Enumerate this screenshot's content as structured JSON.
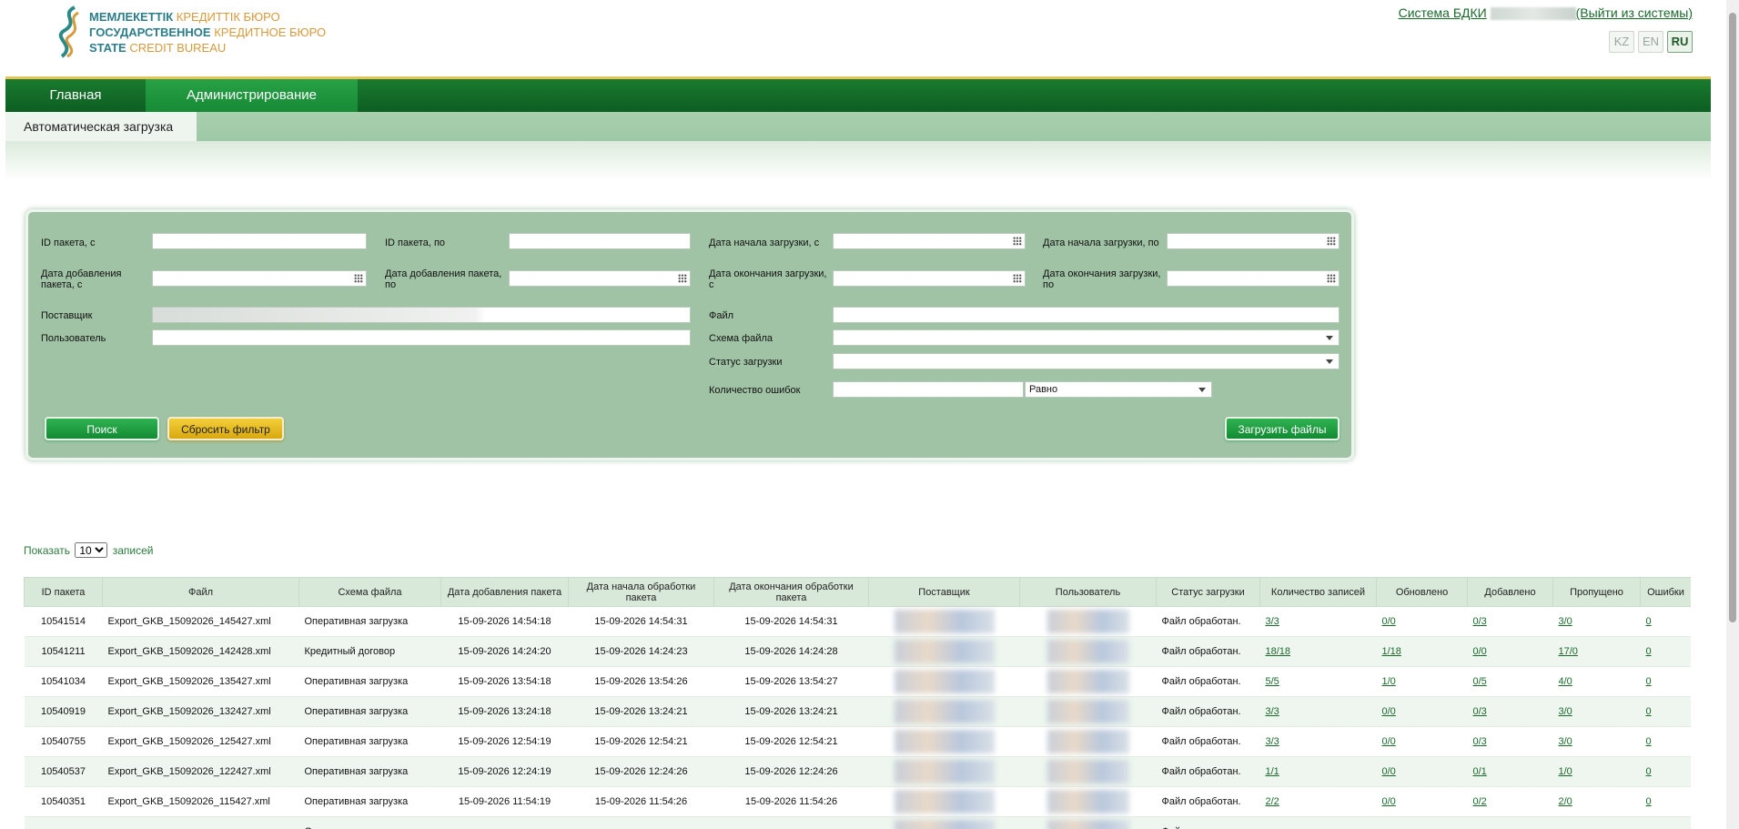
{
  "header": {
    "logo_lines": [
      {
        "bold": "МЕМЛЕКЕТТІК",
        "rest": "КРЕДИТТІК БЮРО"
      },
      {
        "bold": "ГОСУДАРСТВЕННОЕ",
        "rest": "КРЕДИТНОЕ БЮРО"
      },
      {
        "bold": "STATE",
        "rest": "CREDIT BUREAU"
      }
    ],
    "system_link": "Система БДКИ",
    "logout_link": "(Выйти из системы)",
    "languages": [
      "KZ",
      "EN",
      "RU"
    ],
    "active_language": "RU"
  },
  "nav": {
    "main": "Главная",
    "admin": "Администрирование",
    "subtab": "Автоматическая загрузка"
  },
  "filter": {
    "package_id_from": "ID пакета, с",
    "package_id_to": "ID пакета, по",
    "load_start_from": "Дата начала загрузки, с",
    "load_start_to": "Дата начала загрузки, по",
    "added_from": "Дата добавления пакета, с",
    "added_to": "Дата добавления пакета, по",
    "load_end_from": "Дата окончания загрузки, с",
    "load_end_to": "Дата окончания загрузки, по",
    "supplier": "Поставщик",
    "user": "Пользователь",
    "file": "Файл",
    "schema": "Схема файла",
    "status": "Статус загрузки",
    "error_count": "Количество ошибок",
    "error_operator": "Равно",
    "search_btn": "Поиск",
    "reset_btn": "Сбросить фильтр",
    "upload_btn": "Загрузить файлы"
  },
  "show": {
    "prefix": "Показать",
    "value": "10",
    "suffix": "записей"
  },
  "table": {
    "headers": [
      "ID пакета",
      "Файл",
      "Схема файла",
      "Дата добавления пакета",
      "Дата начала обработки пакета",
      "Дата окончания обработки пакета",
      "Поставщик",
      "Пользователь",
      "Статус загрузки",
      "Количество записей",
      "Обновлено",
      "Добавлено",
      "Пропущено",
      "Ошибки"
    ],
    "rows": [
      [
        "10541514",
        "Export_GKB_15092026_145427.xml",
        "Оперативная загрузка",
        "15-09-2026 14:54:18",
        "15-09-2026 14:54:31",
        "15-09-2026 14:54:31",
        "Файл обработан.",
        "3/3",
        "0/0",
        "0/3",
        "3/0",
        "0"
      ],
      [
        "10541211",
        "Export_GKB_15092026_142428.xml",
        "Кредитный договор",
        "15-09-2026 14:24:20",
        "15-09-2026 14:24:23",
        "15-09-2026 14:24:28",
        "Файл обработан.",
        "18/18",
        "1/18",
        "0/0",
        "17/0",
        "0"
      ],
      [
        "10541034",
        "Export_GKB_15092026_135427.xml",
        "Оперативная загрузка",
        "15-09-2026 13:54:18",
        "15-09-2026 13:54:26",
        "15-09-2026 13:54:27",
        "Файл обработан.",
        "5/5",
        "1/0",
        "0/5",
        "4/0",
        "0"
      ],
      [
        "10540919",
        "Export_GKB_15092026_132427.xml",
        "Оперативная загрузка",
        "15-09-2026 13:24:18",
        "15-09-2026 13:24:21",
        "15-09-2026 13:24:21",
        "Файл обработан.",
        "3/3",
        "0/0",
        "0/3",
        "3/0",
        "0"
      ],
      [
        "10540755",
        "Export_GKB_15092026_125427.xml",
        "Оперативная загрузка",
        "15-09-2026 12:54:19",
        "15-09-2026 12:54:21",
        "15-09-2026 12:54:21",
        "Файл обработан.",
        "3/3",
        "0/0",
        "0/3",
        "3/0",
        "0"
      ],
      [
        "10540537",
        "Export_GKB_15092026_122427.xml",
        "Оперативная загрузка",
        "15-09-2026 12:24:19",
        "15-09-2026 12:24:26",
        "15-09-2026 12:24:26",
        "Файл обработан.",
        "1/1",
        "0/0",
        "0/1",
        "1/0",
        "0"
      ],
      [
        "10540351",
        "Export_GKB_15092026_115427.xml",
        "Оперативная загрузка",
        "15-09-2026 11:54:19",
        "15-09-2026 11:54:26",
        "15-09-2026 11:54:26",
        "Файл обработан.",
        "2/2",
        "0/0",
        "0/2",
        "2/0",
        "0"
      ],
      [
        "",
        "",
        "Оперативная загрузка",
        "",
        "",
        "",
        "Файл",
        "",
        "",
        "",
        "",
        ""
      ]
    ]
  }
}
